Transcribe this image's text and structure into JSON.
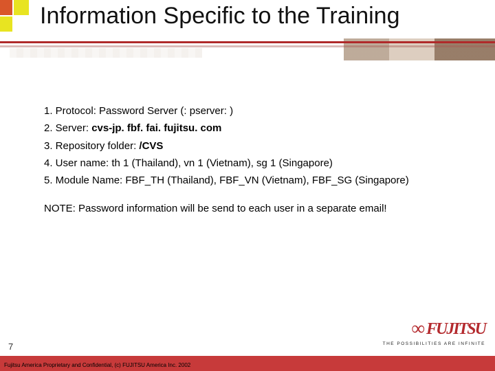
{
  "header": {
    "title": "Information Specific to the Training"
  },
  "content": {
    "line1_prefix": "1. Protocol: Password Server (: pserver: )",
    "line2_prefix": "2. Server: ",
    "line2_bold": "cvs-jp. fbf. fai. fujitsu. com",
    "line3_prefix": "3. Repository folder: ",
    "line3_bold": "/CVS",
    "line4": "4. User name: th 1 (Thailand), vn 1 (Vietnam), sg 1 (Singapore)",
    "line5": "5. Module Name: FBF_TH (Thailand), FBF_VN (Vietnam), FBF_SG (Singapore)",
    "note": "NOTE: Password information will be send to each user in a separate email!"
  },
  "footer": {
    "page_number": "7",
    "brand": "FUJITSU",
    "tagline": "THE POSSIBILITIES ARE INFINITE",
    "copyright": "Fujitsu America Proprietary and Confidential, (c) FUJITSU America Inc. 2002"
  }
}
